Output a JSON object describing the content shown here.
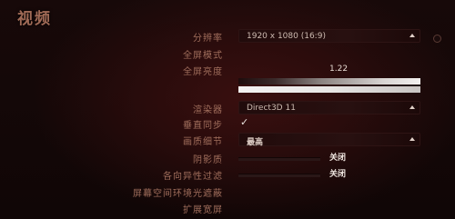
{
  "page": {
    "title": "视频"
  },
  "settings": {
    "resolution": {
      "label": "分辨率",
      "value": "1920 x 1080 (16:9)"
    },
    "fullscreen": {
      "label": "全屏模式"
    },
    "gamma": {
      "label": "全屏亮度",
      "value": "1.22"
    },
    "renderer": {
      "label": "渲染器",
      "value": "Direct3D 11"
    },
    "vsync": {
      "label": "垂直同步",
      "checked": true,
      "mark": "✓"
    },
    "quality": {
      "label": "画质细节",
      "value": "最高"
    },
    "shadows": {
      "label": "阴影质",
      "value": "关闭"
    },
    "anisotropic": {
      "label": "各向异性过滤",
      "value": "关闭"
    },
    "ambient": {
      "label": "屏幕空间环境光遮蔽"
    },
    "widescreen": {
      "label": "扩展宽屏"
    }
  }
}
